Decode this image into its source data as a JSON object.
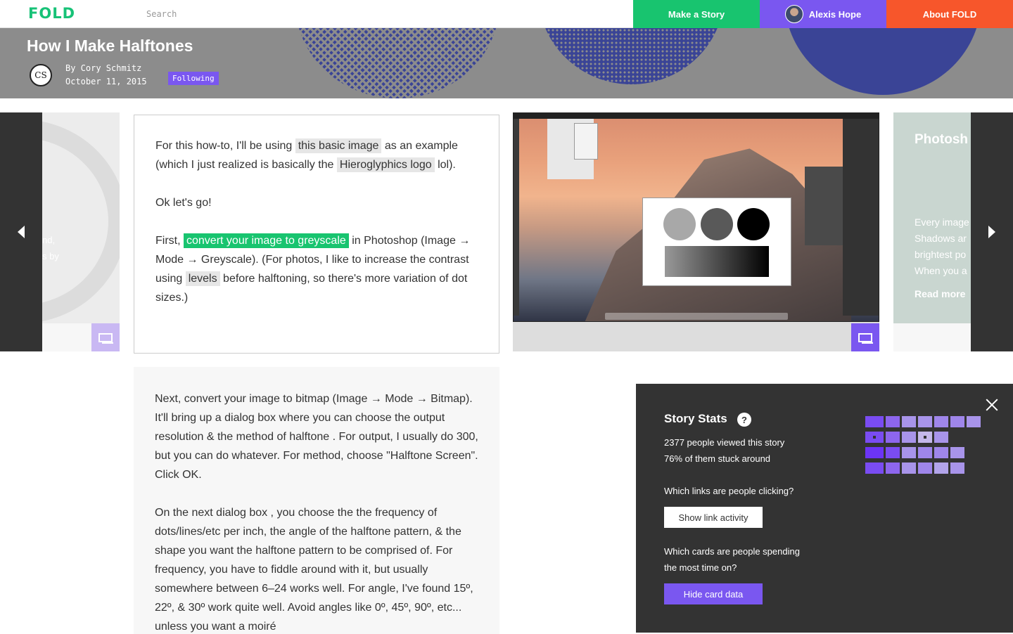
{
  "app": {
    "logo": "FOLD"
  },
  "search": {
    "placeholder": "Search"
  },
  "nav": {
    "make_story": "Make a Story",
    "user_name": "Alexis Hope",
    "about": "About FOLD"
  },
  "colors": {
    "accent_green": "#18c46f",
    "accent_purple": "#7a57f0",
    "accent_orange": "#f7562b",
    "hero_blue": "#3a4496"
  },
  "story": {
    "title": "How I Make Halftones",
    "author_initials": "CS",
    "author": "By Cory Schmitz",
    "date": "October 11, 2015",
    "follow_label": "Following"
  },
  "prev_card": {
    "line1": "nd,",
    "line2": "s by"
  },
  "card1": {
    "p1_a": "For this how-to, I'll be using ",
    "link_basic_image": "this basic image",
    "p1_b": " as an example (which I just realized is basically the ",
    "link_hieroglyphics": "Hieroglyphics logo",
    "p1_c": " lol).",
    "p2": "Ok let's go!",
    "p3_a": "First, ",
    "link_greyscale": "convert your image to greyscale",
    "p3_b": " in Photoshop (Image → Mode → Greyscale). (For photos, I like to increase the contrast using ",
    "link_levels": "levels",
    "p3_c": " before halftoning, so there's more variation of dot sizes.)"
  },
  "card2": {
    "p1": "Next,  convert your image to bitmap  (Image → Mode → Bitmap). It'll bring up  a dialog box where you can choose the output resolution & the method of halftone . For output, I usually do 300, but you can do whatever. For method, choose \"Halftone Screen\". Click OK.",
    "p2": "On  the next dialog box , you choose the the frequency of dots/lines/etc per inch, the angle of the halftone pattern, & the shape you want the halftone pattern to be comprised of. For frequency, you have to fiddle around with it, but usually somewhere between 6–24 works well. For angle, I've found 15º, 22º, & 30º work quite well. Avoid angles like 0º, 45º, 90º, etc... unless you want a  moiré"
  },
  "next_card": {
    "title": "Photosh",
    "lines": [
      "Every image",
      "Shadows ar",
      "brightest po",
      "When you a"
    ],
    "read_more": "Read more"
  },
  "stats": {
    "title": "Story Stats",
    "help_icon": "?",
    "viewed": "2377 people viewed this story",
    "stuck": "76% of them stuck around",
    "links_question": "Which links are people clicking?",
    "show_link_activity": "Show link activity",
    "cards_question_1": "Which cards are people spending",
    "cards_question_2": "the most time on?",
    "hide_card_data": "Hide card data"
  },
  "stats_grid": [
    [
      "#7a4cf2",
      "#8d66ee",
      "#a894ea",
      "#a894ea",
      "#9f86ea",
      "#9f86ea",
      "#a894ea"
    ],
    [
      "#7a4cf2",
      "#8d66ee",
      "#a894ea",
      "#c4b8ea",
      "#a894ea"
    ],
    [
      "#6c34f6",
      "#7a4cf2",
      "#a894ea",
      "#9f86ea",
      "#9f86ea",
      "#a894ea"
    ],
    [
      "#7a4cf2",
      "#8d66ee",
      "#a894ea",
      "#9f86ea",
      "#b2a4ea",
      "#a894ea"
    ]
  ]
}
